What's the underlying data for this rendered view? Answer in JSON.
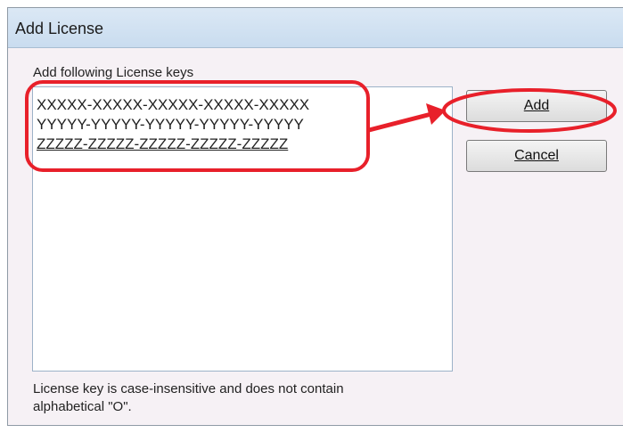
{
  "window": {
    "title": "Add License"
  },
  "form": {
    "group_label": "Add following License keys",
    "keys": [
      "XXXXX-XXXXX-XXXXX-XXXXX-XXXXX",
      "YYYYY-YYYYY-YYYYY-YYYYY-YYYYY",
      "ZZZZZ-ZZZZZ-ZZZZZ-ZZZZZ-ZZZZZ"
    ],
    "note_line1": "License key is case-insensitive and does not contain",
    "note_line2": "alphabetical \"O\"."
  },
  "buttons": {
    "add_label": "Add",
    "cancel_label": "Cancel"
  },
  "colors": {
    "annotation": "#e8202a",
    "titlebar": "#cfe0f1"
  }
}
